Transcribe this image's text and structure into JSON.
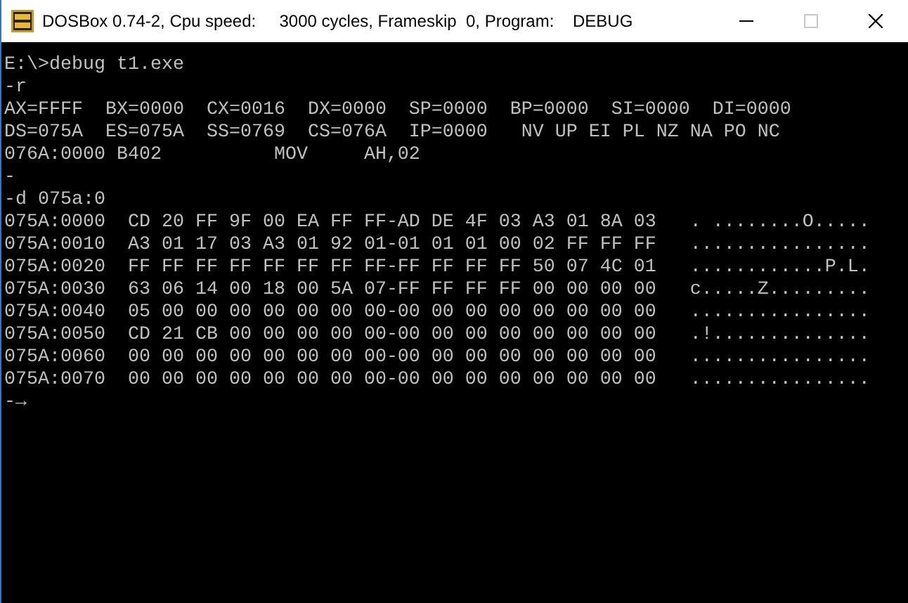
{
  "window": {
    "title": "DOSBox 0.74-2, Cpu speed:     3000 cycles, Frameskip  0, Program:    DEBUG",
    "controls": [
      {
        "kind": "minimize",
        "disabled": false
      },
      {
        "kind": "maximize",
        "disabled": true
      },
      {
        "kind": "close",
        "disabled": false
      }
    ]
  },
  "console": {
    "lines": [
      "E:\\>debug t1.exe",
      "-r",
      "AX=FFFF  BX=0000  CX=0016  DX=0000  SP=0000  BP=0000  SI=0000  DI=0000",
      "DS=075A  ES=075A  SS=0769  CS=076A  IP=0000   NV UP EI PL NZ NA PO NC",
      "076A:0000 B402          MOV     AH,02",
      "-",
      "-d 075a:0",
      "075A:0000  CD 20 FF 9F 00 EA FF FF-AD DE 4F 03 A3 01 8A 03   . ........O.....",
      "075A:0010  A3 01 17 03 A3 01 92 01-01 01 01 00 02 FF FF FF   ................",
      "075A:0020  FF FF FF FF FF FF FF FF-FF FF FF FF 50 07 4C 01   ............P.L.",
      "075A:0030  63 06 14 00 18 00 5A 07-FF FF FF FF 00 00 00 00   c.....Z.........",
      "075A:0040  05 00 00 00 00 00 00 00-00 00 00 00 00 00 00 00   ................",
      "075A:0050  CD 21 CB 00 00 00 00 00-00 00 00 00 00 00 00 00   .!..............",
      "075A:0060  00 00 00 00 00 00 00 00-00 00 00 00 00 00 00 00   ................",
      "075A:0070  00 00 00 00 00 00 00 00-00 00 00 00 00 00 00 00   ................",
      "-→"
    ]
  }
}
